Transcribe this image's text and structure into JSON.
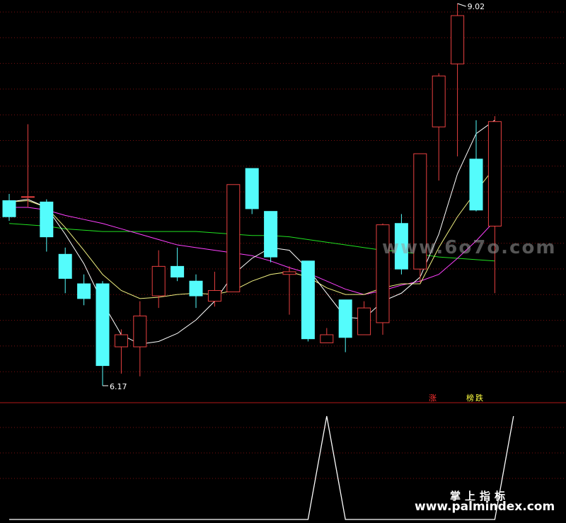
{
  "colors": {
    "background": "#000000",
    "grid": "#7a1010",
    "up": "#e84040",
    "down": "#54fcfc",
    "ma_fast": "#ffffff",
    "ma_mid": "#f0f080",
    "ma_slow": "#ff40ff",
    "ma_long": "#20e020",
    "indicator": "#ffffff",
    "label_red": "#ff3030",
    "label_yellow": "#ffff40"
  },
  "chart_data": {
    "type": "candlestick",
    "price_range": [
      5.6,
      9.02
    ],
    "candles": [
      {
        "o": 7.55,
        "h": 7.6,
        "l": 7.4,
        "c": 7.43
      },
      {
        "o": 7.58,
        "h": 8.12,
        "l": 7.5,
        "c": 7.58
      },
      {
        "o": 7.54,
        "h": 7.56,
        "l": 7.17,
        "c": 7.28
      },
      {
        "o": 7.15,
        "h": 7.2,
        "l": 6.86,
        "c": 6.97
      },
      {
        "o": 6.93,
        "h": 7.0,
        "l": 6.77,
        "c": 6.82
      },
      {
        "o": 6.93,
        "h": 6.95,
        "l": 6.17,
        "c": 6.32
      },
      {
        "o": 6.46,
        "h": 6.59,
        "l": 6.26,
        "c": 6.55
      },
      {
        "o": 6.46,
        "h": 6.8,
        "l": 6.24,
        "c": 6.69
      },
      {
        "o": 6.84,
        "h": 7.18,
        "l": 6.75,
        "c": 7.06
      },
      {
        "o": 7.06,
        "h": 7.2,
        "l": 6.95,
        "c": 6.98
      },
      {
        "o": 6.95,
        "h": 7.0,
        "l": 6.75,
        "c": 6.84
      },
      {
        "o": 6.8,
        "h": 7.02,
        "l": 6.76,
        "c": 6.88
      },
      {
        "o": 6.87,
        "h": 7.67,
        "l": 6.87,
        "c": 7.67
      },
      {
        "o": 7.79,
        "h": 7.79,
        "l": 7.45,
        "c": 7.49
      },
      {
        "o": 7.47,
        "h": 7.47,
        "l": 7.09,
        "c": 7.13
      },
      {
        "o": 7.0,
        "h": 7.06,
        "l": 6.7,
        "c": 7.02
      },
      {
        "o": 7.1,
        "h": 7.1,
        "l": 6.5,
        "c": 6.52
      },
      {
        "o": 6.49,
        "h": 6.6,
        "l": 6.49,
        "c": 6.55
      },
      {
        "o": 6.81,
        "h": 6.81,
        "l": 6.42,
        "c": 6.53
      },
      {
        "o": 6.55,
        "h": 6.8,
        "l": 6.55,
        "c": 6.75
      },
      {
        "o": 6.64,
        "h": 7.38,
        "l": 6.55,
        "c": 7.37
      },
      {
        "o": 7.38,
        "h": 7.45,
        "l": 7.0,
        "c": 7.04
      },
      {
        "o": 7.04,
        "h": 7.9,
        "l": 6.94,
        "c": 7.9
      },
      {
        "o": 8.1,
        "h": 8.5,
        "l": 7.7,
        "c": 8.48
      },
      {
        "o": 8.57,
        "h": 9.02,
        "l": 7.88,
        "c": 8.93
      },
      {
        "o": 7.86,
        "h": 8.15,
        "l": 7.47,
        "c": 7.48
      },
      {
        "o": 7.36,
        "h": 8.18,
        "l": 6.86,
        "c": 8.14
      }
    ],
    "ma_fast": [
      7.54,
      7.56,
      7.5,
      7.3,
      7.08,
      6.79,
      6.55,
      6.48,
      6.5,
      6.56,
      6.66,
      6.8,
      7.0,
      7.12,
      7.2,
      7.18,
      7.04,
      6.86,
      6.68,
      6.67,
      6.8,
      6.86,
      6.98,
      7.3,
      7.75,
      8.05,
      8.15
    ],
    "ma_mid": [
      7.54,
      7.55,
      7.5,
      7.35,
      7.18,
      7.0,
      6.88,
      6.82,
      6.83,
      6.85,
      6.86,
      6.85,
      6.88,
      6.95,
      7.0,
      7.02,
      6.98,
      6.9,
      6.85,
      6.85,
      6.9,
      6.93,
      6.93,
      7.2,
      7.43,
      7.62,
      7.8
    ],
    "ma_slow": [
      7.5,
      7.5,
      7.48,
      7.44,
      7.41,
      7.38,
      7.34,
      7.3,
      7.26,
      7.22,
      7.2,
      7.18,
      7.16,
      7.14,
      7.1,
      7.05,
      7.01,
      6.95,
      6.89,
      6.85,
      6.88,
      6.92,
      6.95,
      7.0,
      7.12,
      7.25,
      7.4
    ],
    "ma_long": [
      7.38,
      7.37,
      7.36,
      7.34,
      7.33,
      7.32,
      7.32,
      7.32,
      7.32,
      7.32,
      7.32,
      7.31,
      7.3,
      7.29,
      7.29,
      7.28,
      7.26,
      7.24,
      7.22,
      7.2,
      7.18,
      7.17,
      7.15,
      7.13,
      7.12,
      7.11,
      7.1
    ],
    "high_label": "9.02",
    "low_label": "6.17",
    "indicator": {
      "spike_indices": [
        17,
        27
      ],
      "zh_labels": [
        "涨",
        "榜",
        "跌"
      ]
    }
  },
  "watermarks": {
    "big": "www.6o7o.com",
    "chinese": "掌上指标",
    "url": "www.palmindex.com"
  }
}
